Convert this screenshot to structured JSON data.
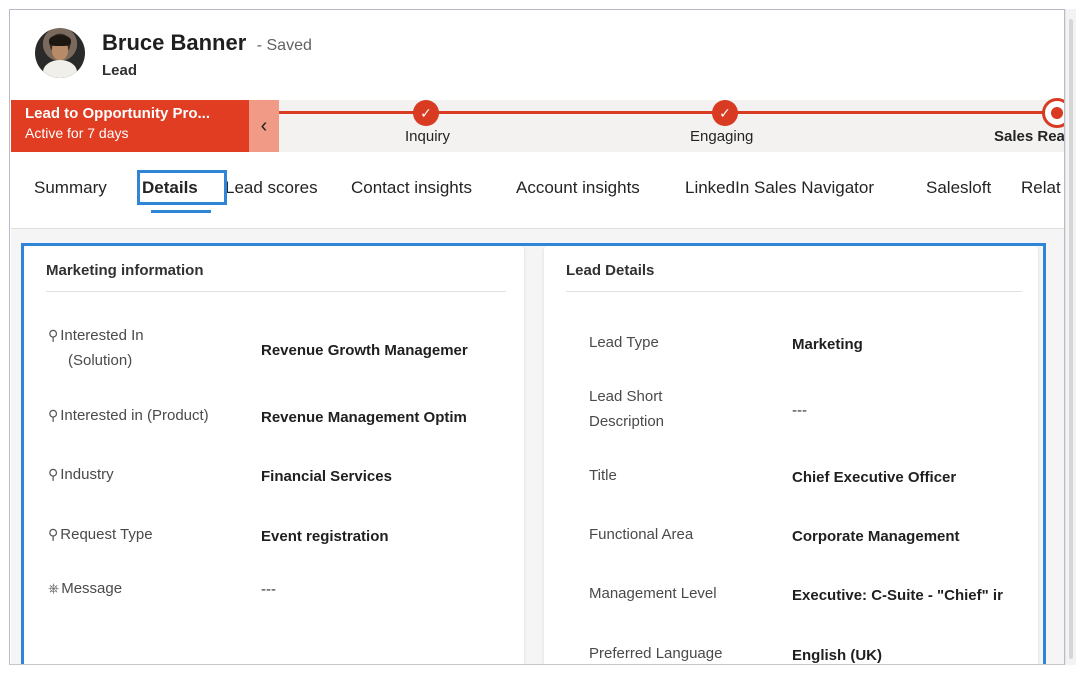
{
  "record": {
    "name": "Bruce Banner",
    "saved_status": "- Saved",
    "entity": "Lead",
    "avatar_icon": "user-avatar"
  },
  "bpf": {
    "process_name": "Lead to Opportunity Pro...",
    "active_duration": "Active for 7 days",
    "collapse_icon": "chevron-left-icon",
    "stages": [
      {
        "label": "Inquiry",
        "status": "completed"
      },
      {
        "label": "Engaging",
        "status": "completed"
      },
      {
        "label": "Sales Read",
        "status": "active"
      }
    ],
    "accent_color": "#d83b21"
  },
  "tabs": [
    {
      "label": "Summary",
      "active": false
    },
    {
      "label": "Details",
      "active": true
    },
    {
      "label": "Lead scores",
      "active": false
    },
    {
      "label": "Contact insights",
      "active": false
    },
    {
      "label": "Account insights",
      "active": false
    },
    {
      "label": "LinkedIn Sales Navigator",
      "active": false
    },
    {
      "label": "Salesloft",
      "active": false
    },
    {
      "label": "Relat",
      "active": false
    }
  ],
  "marketing_info": {
    "title": "Marketing information",
    "fields": [
      {
        "label_line1": "Interested In",
        "label_line2": "(Solution)",
        "value": "Revenue Growth Managemer",
        "icon": "search-icon"
      },
      {
        "label_line1": "Interested in (Product)",
        "label_line2": "",
        "value": "Revenue Management Optim",
        "icon": "search-icon"
      },
      {
        "label_line1": "Industry",
        "label_line2": "",
        "value": "Financial Services",
        "icon": "search-icon"
      },
      {
        "label_line1": "Request Type",
        "label_line2": "",
        "value": "Event registration",
        "icon": "search-icon"
      },
      {
        "label_line1": "Message",
        "label_line2": "",
        "value": "---",
        "icon": "lock-icon"
      }
    ]
  },
  "lead_details": {
    "title": "Lead Details",
    "fields": [
      {
        "label_line1": "Lead Type",
        "label_line2": "",
        "value": "Marketing"
      },
      {
        "label_line1": "Lead Short",
        "label_line2": "Description",
        "value": "---"
      },
      {
        "label_line1": "Title",
        "label_line2": "",
        "value": "Chief Executive Officer"
      },
      {
        "label_line1": "Functional Area",
        "label_line2": "",
        "value": "Corporate Management"
      },
      {
        "label_line1": "Management Level",
        "label_line2": "",
        "value": "Executive: C-Suite - \"Chief\" ir"
      },
      {
        "label_line1": "Preferred Language",
        "label_line2": "",
        "value": "English (UK)"
      }
    ]
  },
  "highlight_color": "#2f86d6"
}
